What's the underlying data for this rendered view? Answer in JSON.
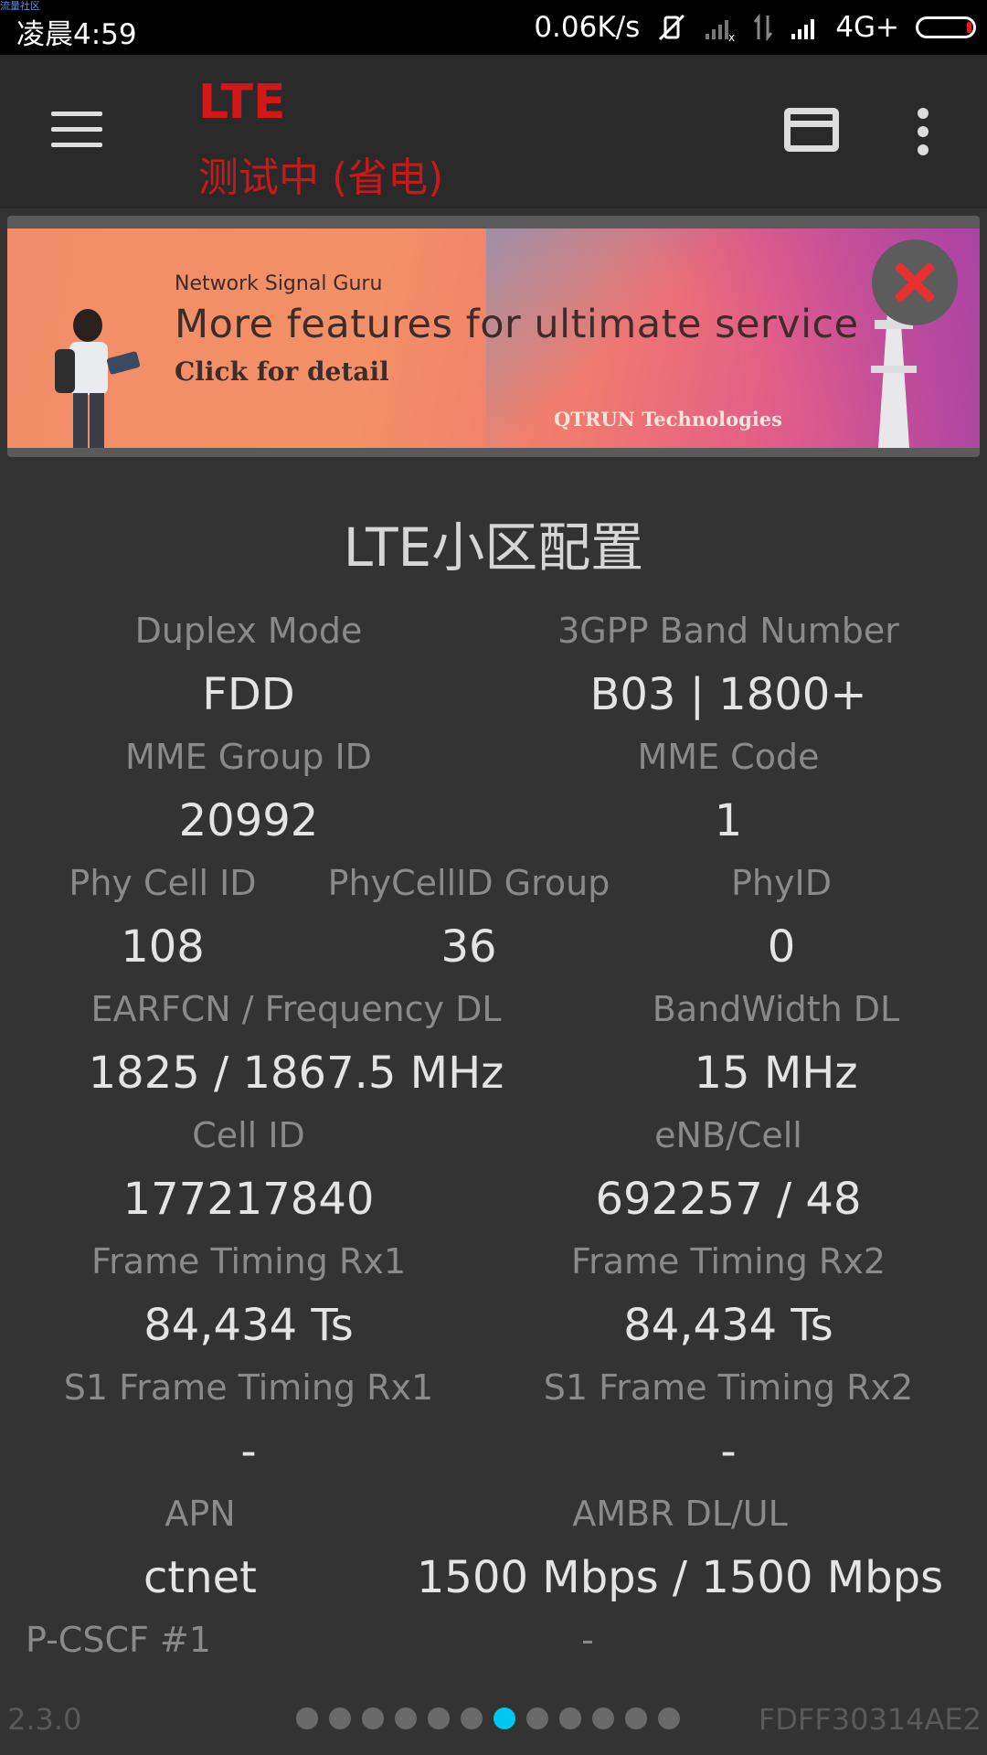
{
  "status_bar": {
    "watermark": "流量社区",
    "time": "凌晨4:59",
    "speed": "0.06K/s",
    "network": "4G+"
  },
  "app_bar": {
    "title": "LTE",
    "subtitle": "测试中 (省电)"
  },
  "banner": {
    "small_text": "Network Signal Guru",
    "headline": "More features for ultimate service",
    "cta": "Click for detail",
    "brand": "QTRUN Technologies"
  },
  "section": {
    "title": "LTE小区配置",
    "rows": [
      {
        "label": "Duplex Mode",
        "value": "FDD"
      },
      {
        "label": "3GPP Band Number",
        "value": "B03 | 1800+"
      },
      {
        "label": "MME Group ID",
        "value": "20992"
      },
      {
        "label": "MME Code",
        "value": "1"
      },
      {
        "label": "Phy Cell ID",
        "value": "108"
      },
      {
        "label": "PhyCellID Group",
        "value": "36"
      },
      {
        "label": "PhyID",
        "value": "0"
      },
      {
        "label": "EARFCN / Frequency DL",
        "value": "1825 / 1867.5 MHz"
      },
      {
        "label": "BandWidth DL",
        "value": "15 MHz"
      },
      {
        "label": "Cell ID",
        "value": "177217840"
      },
      {
        "label": "eNB/Cell",
        "value": "692257 / 48"
      },
      {
        "label": "Frame Timing Rx1",
        "value": "84,434 Ts"
      },
      {
        "label": "Frame Timing Rx2",
        "value": "84,434 Ts"
      },
      {
        "label": "S1 Frame Timing Rx1",
        "value": "-"
      },
      {
        "label": "S1 Frame Timing Rx2",
        "value": "-"
      },
      {
        "label": "APN",
        "value": "ctnet"
      },
      {
        "label": "AMBR DL/UL",
        "value": "1500 Mbps / 1500 Mbps"
      },
      {
        "label": "P-CSCF #1",
        "value": "-"
      }
    ]
  },
  "footer": {
    "version": "2.3.0",
    "serial": "FDFF30314AE2",
    "page_count": 12,
    "active_page": 7
  },
  "colors": {
    "title": "#d01818",
    "active_dot": "#00c8f0",
    "background": "#333333"
  }
}
